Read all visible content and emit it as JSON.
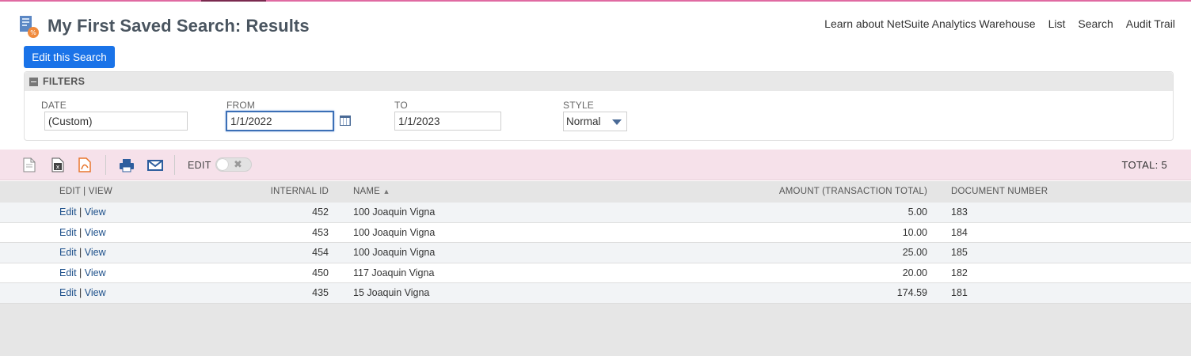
{
  "page": {
    "title": "My First Saved Search: Results",
    "edit_search_label": "Edit this Search"
  },
  "header_links": [
    "Learn about NetSuite Analytics Warehouse",
    "List",
    "Search",
    "Audit Trail"
  ],
  "filters": {
    "heading": "FILTERS",
    "date": {
      "label": "DATE",
      "value": "(Custom)"
    },
    "from": {
      "label": "FROM",
      "value": "1/1/2022"
    },
    "to": {
      "label": "TO",
      "value": "1/1/2023"
    },
    "style": {
      "label": "STYLE",
      "value": "Normal"
    }
  },
  "toolbar": {
    "edit_label": "EDIT",
    "total_label": "TOTAL: 5",
    "icons": [
      "export-csv-icon",
      "export-excel-icon",
      "export-pdf-icon",
      "print-icon",
      "email-icon"
    ]
  },
  "table": {
    "columns": {
      "edit_view": "EDIT | VIEW",
      "internal_id": "INTERNAL ID",
      "name": "NAME",
      "name_sort": "▲",
      "amount": "AMOUNT (TRANSACTION TOTAL)",
      "document_number": "DOCUMENT NUMBER"
    },
    "link_edit": "Edit",
    "link_sep": "|",
    "link_view": "View",
    "rows": [
      {
        "internal_id": "452",
        "name": "100 Joaquin Vigna",
        "amount": "5.00",
        "document_number": "183"
      },
      {
        "internal_id": "453",
        "name": "100 Joaquin Vigna",
        "amount": "10.00",
        "document_number": "184"
      },
      {
        "internal_id": "454",
        "name": "100 Joaquin Vigna",
        "amount": "25.00",
        "document_number": "185"
      },
      {
        "internal_id": "450",
        "name": "117 Joaquin Vigna",
        "amount": "20.00",
        "document_number": "182"
      },
      {
        "internal_id": "435",
        "name": "15 Joaquin Vigna",
        "amount": "174.59",
        "document_number": "181"
      }
    ]
  },
  "colors": {
    "accent": "#1a73e8",
    "toolbar_bg": "#f6e1ea",
    "topbar": "#e06aa2",
    "link": "#1c4f8a"
  }
}
